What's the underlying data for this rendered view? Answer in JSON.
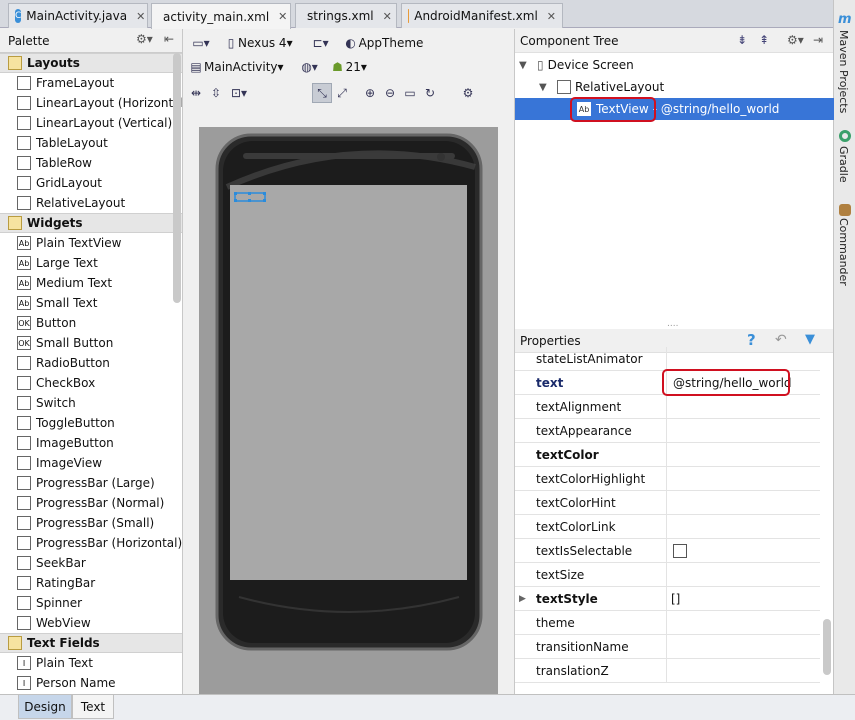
{
  "tabs": [
    {
      "label": "MainActivity.java",
      "icon": "java-class-icon",
      "active": false
    },
    {
      "label": "activity_main.xml",
      "icon": "layout-xml-icon",
      "active": true
    },
    {
      "label": "strings.xml",
      "icon": "xml-icon",
      "active": false
    },
    {
      "label": "AndroidManifest.xml",
      "icon": "manifest-icon",
      "active": false
    }
  ],
  "right_strip": {
    "maven": "Maven Projects",
    "gradle": "Gradle",
    "commander": "Commander"
  },
  "palette": {
    "title": "Palette",
    "groups": [
      {
        "name": "Layouts",
        "items": [
          "FrameLayout",
          "LinearLayout (Horizontal)",
          "LinearLayout (Vertical)",
          "TableLayout",
          "TableRow",
          "GridLayout",
          "RelativeLayout"
        ]
      },
      {
        "name": "Widgets",
        "items": [
          "Plain TextView",
          "Large Text",
          "Medium Text",
          "Small Text",
          "Button",
          "Small Button",
          "RadioButton",
          "CheckBox",
          "Switch",
          "ToggleButton",
          "ImageButton",
          "ImageView",
          "ProgressBar (Large)",
          "ProgressBar (Normal)",
          "ProgressBar (Small)",
          "ProgressBar (Horizontal)",
          "SeekBar",
          "RatingBar",
          "Spinner",
          "WebView"
        ]
      },
      {
        "name": "Text Fields",
        "items": [
          "Plain Text",
          "Person Name"
        ]
      }
    ]
  },
  "toolbar": {
    "device": "Nexus 4",
    "theme": "AppTheme",
    "activity": "MainActivity",
    "api": "21"
  },
  "component_tree": {
    "title": "Component Tree",
    "device_screen": "Device Screen",
    "layout": "RelativeLayout",
    "selected": "TextView",
    "selected_suffix": "- @string/hello_world"
  },
  "properties": {
    "title": "Properties",
    "rows": [
      {
        "name": "stateListAnimator",
        "value": ""
      },
      {
        "name": "text",
        "value": "@string/hello_world"
      },
      {
        "name": "textAlignment",
        "value": ""
      },
      {
        "name": "textAppearance",
        "value": ""
      },
      {
        "name": "textColor",
        "value": ""
      },
      {
        "name": "textColorHighlight",
        "value": ""
      },
      {
        "name": "textColorHint",
        "value": ""
      },
      {
        "name": "textColorLink",
        "value": ""
      },
      {
        "name": "textIsSelectable",
        "value": ""
      },
      {
        "name": "textSize",
        "value": ""
      },
      {
        "name": "textStyle",
        "value": "[]"
      },
      {
        "name": "theme",
        "value": ""
      },
      {
        "name": "transitionName",
        "value": ""
      },
      {
        "name": "translationZ",
        "value": ""
      }
    ]
  },
  "bottom": {
    "design": "Design",
    "text": "Text"
  },
  "colors": {
    "selection": "#3875d7",
    "highlight_box": "#d01020",
    "screen": "#a8a8a8"
  }
}
